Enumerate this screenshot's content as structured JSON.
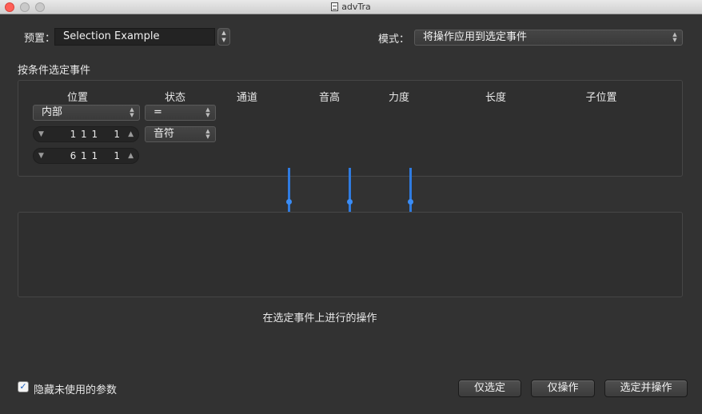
{
  "window": {
    "title": "advTra"
  },
  "preset": {
    "label": "预置：",
    "value": "Selection Example"
  },
  "mode": {
    "label": "模式：",
    "value": "将操作应用到选定事件"
  },
  "conditions": {
    "section_title": "按条件选定事件",
    "columns": [
      "位置",
      "状态",
      "通道",
      "音高",
      "力度",
      "长度",
      "子位置"
    ],
    "position_popup": "内部",
    "status_popup": "=",
    "status_value_popup": "音符",
    "position_start": "1 1 1    1",
    "position_end": "6 1 1    1"
  },
  "operations": {
    "section_title": "在选定事件上进行的操作"
  },
  "footer": {
    "hide_unused_label": "隐藏未使用的参数",
    "hide_unused_checked": true,
    "select_only": "仅选定",
    "operate_only": "仅操作",
    "select_and_operate": "选定并操作"
  },
  "colors": {
    "accent": "#2f7be0",
    "close": "#ff5f57"
  },
  "icons": {
    "stepper": "up-down-stepper-icon",
    "decrement": "triangle-down-icon",
    "increment": "triangle-up-icon",
    "checkmark": "checkmark-icon"
  }
}
